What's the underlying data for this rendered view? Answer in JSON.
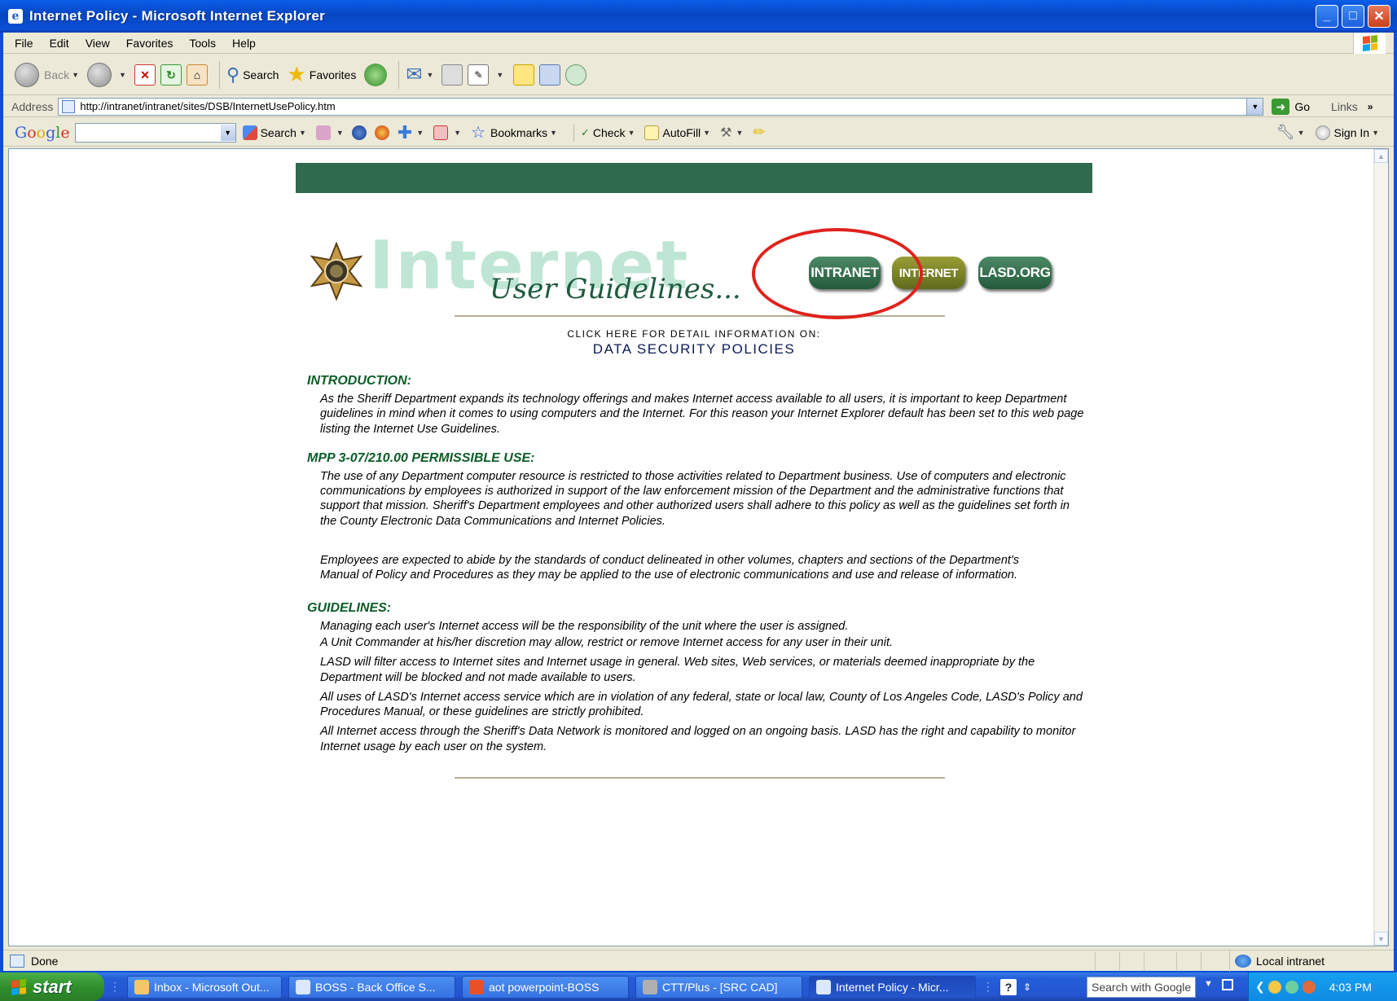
{
  "window": {
    "title": "Internet Policy - Microsoft Internet Explorer",
    "controls": [
      "_",
      "□",
      "✕"
    ]
  },
  "menu": [
    "File",
    "Edit",
    "View",
    "Favorites",
    "Tools",
    "Help"
  ],
  "toolbar": {
    "back": "Back",
    "search": "Search",
    "favorites": "Favorites"
  },
  "address": {
    "label": "Address",
    "url": "http://intranet/intranet/sites/DSB/InternetUsePolicy.htm",
    "go": "Go",
    "links": "Links"
  },
  "google_toolbar": {
    "logo": [
      "G",
      "o",
      "o",
      "g",
      "l",
      "e"
    ],
    "search": "Search",
    "bookmarks": "Bookmarks",
    "check": "Check",
    "autofill": "AutoFill",
    "sign_in": "Sign In"
  },
  "page": {
    "logo_word": "Internet",
    "logo_sub": "User Guidelines...",
    "nav_buttons": {
      "intranet": "INTRANET",
      "internet": "INTERNET",
      "lasd": "LASD.ORG"
    },
    "click_here": "CLICK HERE FOR DETAIL INFORMATION ON:",
    "policies_link": "DATA SECURITY POLICIES",
    "sections": {
      "intro": {
        "title": "INTRODUCTION:",
        "paragraphs": [
          "As the Sheriff Department expands its technology offerings and makes Internet access available to all users, it is important to keep Department guidelines in mind when it comes to using computers and the Internet. For this reason your Internet Explorer default has been set to this web page listing the Internet Use Guidelines."
        ]
      },
      "permissible": {
        "title": "MPP 3-07/210.00 PERMISSIBLE USE:",
        "paragraphs": [
          "The use of any Department computer resource is restricted to those activities related to Department business. Use of computers and electronic communications by employees is authorized in support of the law enforcement mission of the Department and the administrative functions that support that mission. Sheriff's Department employees and other authorized users shall adhere to this policy as well as the guidelines set forth in the County Electronic Data Communications and Internet Policies.",
          "Employees are expected to abide by the standards of conduct delineated in other volumes, chapters and sections of the Department's Manual of Policy and Procedures as they may be applied to the use of electronic communications and use and release of information."
        ]
      },
      "guidelines": {
        "title": "GUIDELINES:",
        "paragraphs": [
          "Managing each user's Internet access will be the responsibility of the unit where the user is assigned.",
          "A Unit Commander at his/her discretion may allow, restrict or remove Internet access for any user in their unit.",
          "LASD will filter access to Internet sites and Internet usage in general. Web sites, Web services, or materials deemed inappropriate by the Department will be blocked and not made available to users.",
          "All uses of LASD's Internet access service which are in violation of any federal, state or local law, County of Los Angeles Code, LASD's Policy and Procedures Manual, or these guidelines are strictly prohibited.",
          "All Internet access through the Sheriff's Data Network is monitored and logged on an ongoing basis. LASD has the right and capability to monitor Internet usage by each user on the system."
        ]
      }
    }
  },
  "status": {
    "text": "Done",
    "zone": "Local intranet"
  },
  "taskbar": {
    "start": "start",
    "tasks": [
      "Inbox - Microsoft Out...",
      "BOSS - Back Office S...",
      "aot powerpoint-BOSS",
      "CTT/Plus - [SRC CAD]",
      "Internet Policy - Micr..."
    ],
    "search_placeholder": "Search with Google",
    "clock": "4:03 PM"
  },
  "colors": {
    "banner_green": "#2f6a4c",
    "section_title": "#0c5d28",
    "callout_red": "#e0221d",
    "titlebar_blue": "#0a4fd6"
  }
}
